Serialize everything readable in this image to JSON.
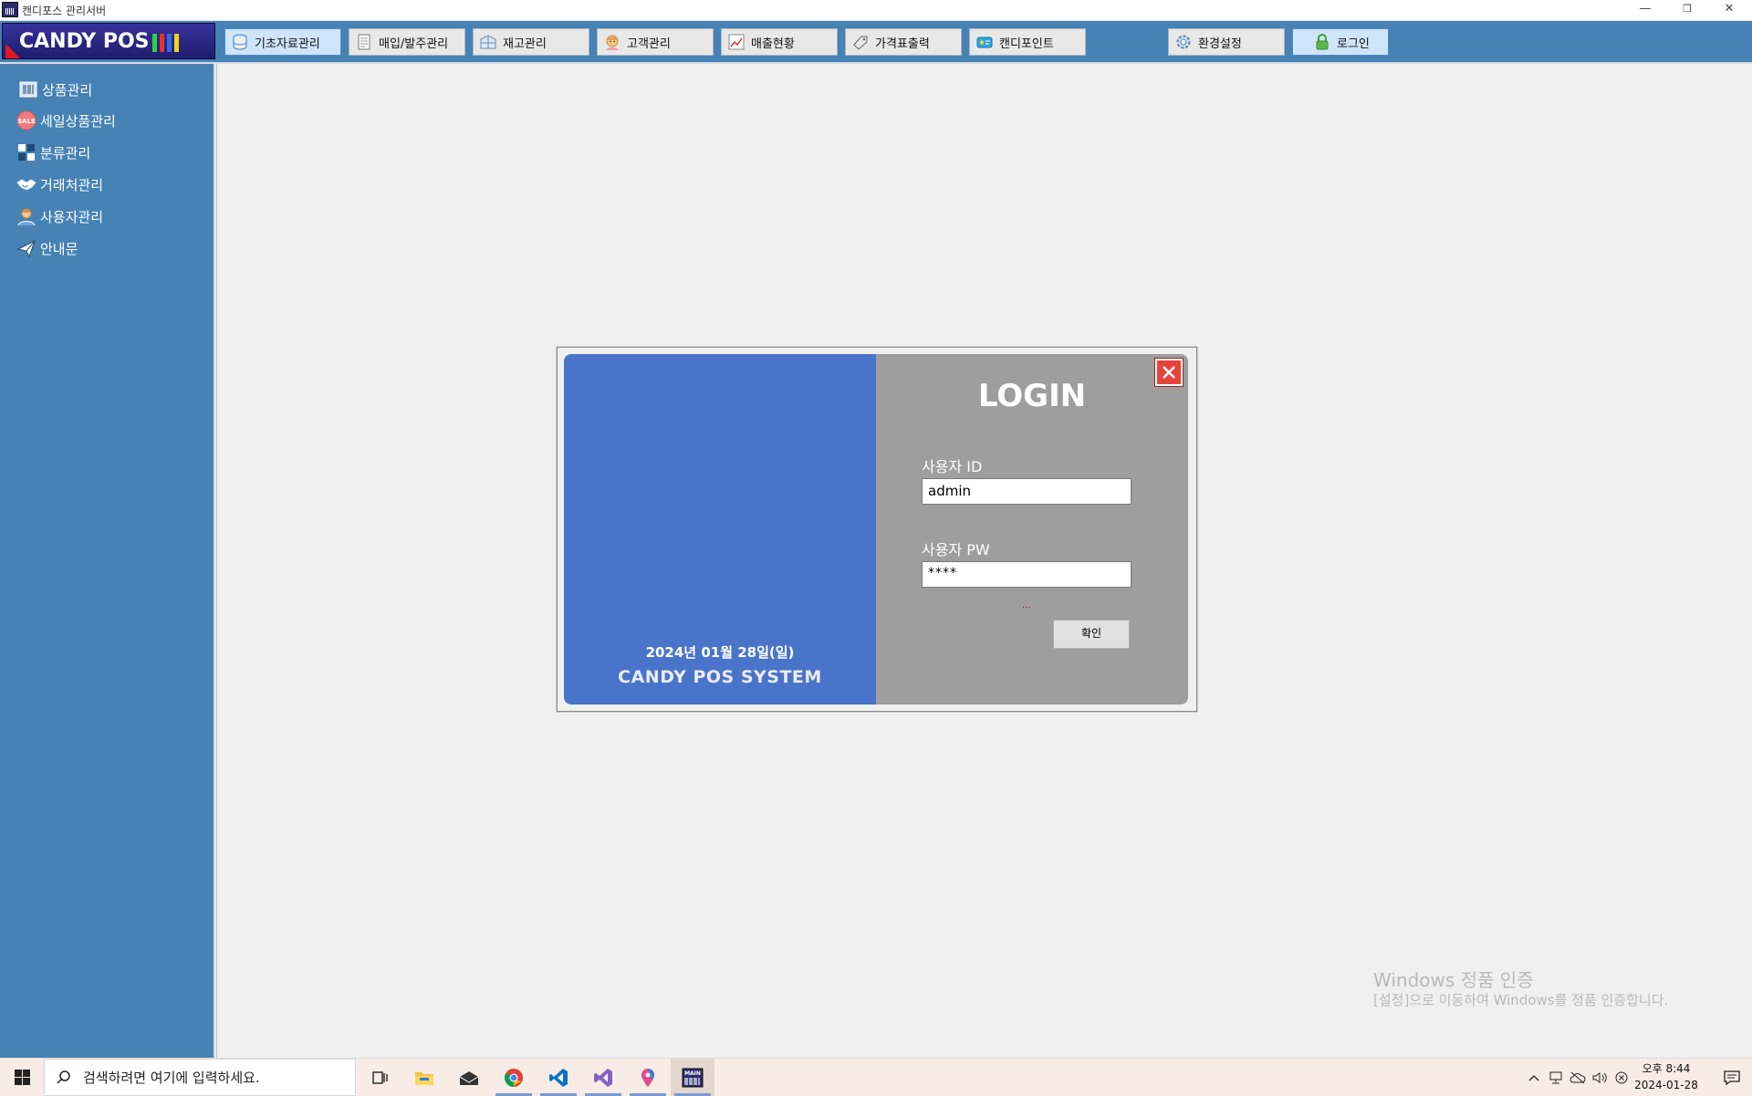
{
  "window": {
    "title": "캔디포스 관리서버",
    "controls": {
      "minimize": "—",
      "restore": "❐",
      "close": "✕"
    }
  },
  "brand": {
    "name": "CANDY POS",
    "bar_colors": [
      "#2bd14a",
      "#e8322b",
      "#2f6ae0",
      "#f2d21b"
    ]
  },
  "menu": [
    {
      "label": "기초자료관리",
      "icon": "database-icon",
      "active": true
    },
    {
      "label": "매입/발주관리",
      "icon": "document-icon"
    },
    {
      "label": "재고관리",
      "icon": "warehouse-icon"
    },
    {
      "label": "고객관리",
      "icon": "customer-icon"
    },
    {
      "label": "매출현황",
      "icon": "sales-chart-icon"
    },
    {
      "label": "가격표출력",
      "icon": "price-tag-icon"
    },
    {
      "label": "캔디포인트",
      "icon": "point-card-icon"
    },
    {
      "label": "환경설정",
      "icon": "gear-icon"
    },
    {
      "label": "로그인",
      "icon": "lock-icon",
      "highlight": true
    }
  ],
  "sidebar": {
    "items": [
      {
        "label": "상품관리",
        "icon": "barcode-icon"
      },
      {
        "label": "세일상품관리",
        "icon": "sale-badge-icon"
      },
      {
        "label": "분류관리",
        "icon": "grid-icon"
      },
      {
        "label": "거래처관리",
        "icon": "handshake-icon"
      },
      {
        "label": "사용자관리",
        "icon": "user-icon"
      },
      {
        "label": "안내문",
        "icon": "paper-plane-icon"
      }
    ]
  },
  "login": {
    "title": "LOGIN",
    "date": "2024년 01월 28일(일)",
    "system_name": "CANDY POS SYSTEM",
    "id_label": "사용자 ID",
    "id_value": "admin",
    "pw_label": "사용자 PW",
    "pw_value": "****",
    "message": "...",
    "confirm_label": "확인",
    "panel_colors": {
      "left": "#4a74c9",
      "right": "#9e9e9e"
    }
  },
  "watermark": {
    "line1": "Windows 정품 인증",
    "line2": "[설정]으로 이동하여 Windows를 정품 인증합니다."
  },
  "taskbar": {
    "search_placeholder": "검색하려면 여기에 입력하세요.",
    "apps": [
      "task-view-icon",
      "file-explorer-icon",
      "mail-icon",
      "chrome-icon",
      "vscode-icon",
      "visual-studio-icon",
      "maps-pin-icon",
      "candy-pos-main-icon"
    ],
    "time": "오후 8:44",
    "date": "2024-01-28"
  }
}
